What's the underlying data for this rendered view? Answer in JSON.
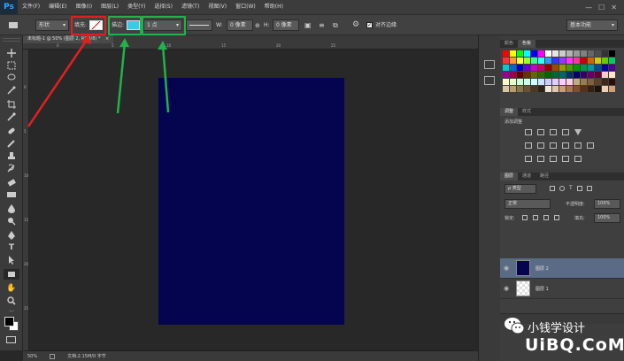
{
  "menubar": {
    "logo": "Ps",
    "items": [
      "文件(F)",
      "编辑(E)",
      "图像(I)",
      "图层(L)",
      "类型(Y)",
      "选择(S)",
      "滤镜(T)",
      "视图(V)",
      "窗口(W)",
      "帮助(H)"
    ],
    "window_controls": [
      "—",
      "☐",
      "✕"
    ]
  },
  "options": {
    "mode": "形状",
    "fill_label": "填充:",
    "stroke_label": "描边:",
    "stroke_width": "1 点",
    "w_label": "W:",
    "w_value": "0 像素",
    "h_label": "H:",
    "h_value": "0 像素",
    "align_edges": "对齐边缘",
    "workspace": "基本功能",
    "stroke_color": "#3ec8e6"
  },
  "document": {
    "tab_title": "未标题-1 @ 50% (图层 2, RGB/8) *",
    "canvas_color": "#04044f",
    "ruler_top": [
      "0",
      "5",
      "10",
      "15",
      "20",
      "25"
    ],
    "ruler_left": [
      "0",
      "5",
      "10",
      "15",
      "20",
      "25"
    ]
  },
  "status": {
    "zoom": "50%",
    "doc_info": "文档:2.15M/0 字节"
  },
  "swatches_panel": {
    "tabs": [
      "颜色",
      "色板"
    ],
    "colors": [
      "#ff0000",
      "#ffff00",
      "#00ff00",
      "#00ffff",
      "#0000ff",
      "#ff00ff",
      "#ffffff",
      "#e6e6e6",
      "#cccccc",
      "#b3b3b3",
      "#999999",
      "#808080",
      "#666666",
      "#4d4d4d",
      "#333333",
      "#000000",
      "#ff3333",
      "#ff9933",
      "#ffff33",
      "#99ff33",
      "#33ff99",
      "#33ffff",
      "#3399ff",
      "#3333ff",
      "#9933ff",
      "#ff33ff",
      "#ff3399",
      "#cc0000",
      "#cc6600",
      "#cccc00",
      "#66cc00",
      "#00cc66",
      "#00cccc",
      "#0066cc",
      "#0000cc",
      "#6600cc",
      "#cc00cc",
      "#cc0066",
      "#990000",
      "#994c00",
      "#999900",
      "#4c9900",
      "#009900",
      "#00994c",
      "#009999",
      "#004c99",
      "#000099",
      "#4c0099",
      "#990099",
      "#99004c",
      "#660000",
      "#663300",
      "#666600",
      "#336600",
      "#006600",
      "#006633",
      "#006666",
      "#003366",
      "#000066",
      "#330066",
      "#660066",
      "#660033",
      "#ffcccc",
      "#ffe5cc",
      "#ffffcc",
      "#e5ffcc",
      "#ccffcc",
      "#ccffe5",
      "#ccffff",
      "#cce5ff",
      "#ccccff",
      "#e5ccff",
      "#ffccff",
      "#ffcce5",
      "#c8a882",
      "#a07850",
      "#806040",
      "#604028",
      "#402818",
      "#281008",
      "#d9c9a3",
      "#b89e6e",
      "#8c7548",
      "#6a5433",
      "#4a3822",
      "#2e2215",
      "#f2e6d9",
      "#e0c8a8",
      "#c8a070",
      "#a87848",
      "#805030",
      "#583018",
      "#382010",
      "#201008",
      "#f0d0b0",
      "#d0a078"
    ]
  },
  "adjustments_panel": {
    "tabs": [
      "调整",
      "样式"
    ],
    "title": "添加调整"
  },
  "layers_panel": {
    "tabs": [
      "图层",
      "通道",
      "路径"
    ],
    "filter_kind": "ρ 类型",
    "blend_mode": "正常",
    "opacity_label": "不透明度:",
    "opacity_value": "100%",
    "lock_label": "锁定:",
    "fill_label": "填充:",
    "fill_value": "100%",
    "layers": [
      {
        "name": "图层 2",
        "thumb_color": "#04044f",
        "selected": true
      },
      {
        "name": "图层 1",
        "thumb_color": "checker",
        "selected": false
      }
    ]
  },
  "watermark": {
    "brand_text": "小钱学设计",
    "site_text": "UiBQ.CoM"
  },
  "annotations": {
    "fill_box_color": "#e02020",
    "stroke_box_color": "#22b14c",
    "arrow_red": "#e02020",
    "arrow_green": "#22b14c"
  }
}
